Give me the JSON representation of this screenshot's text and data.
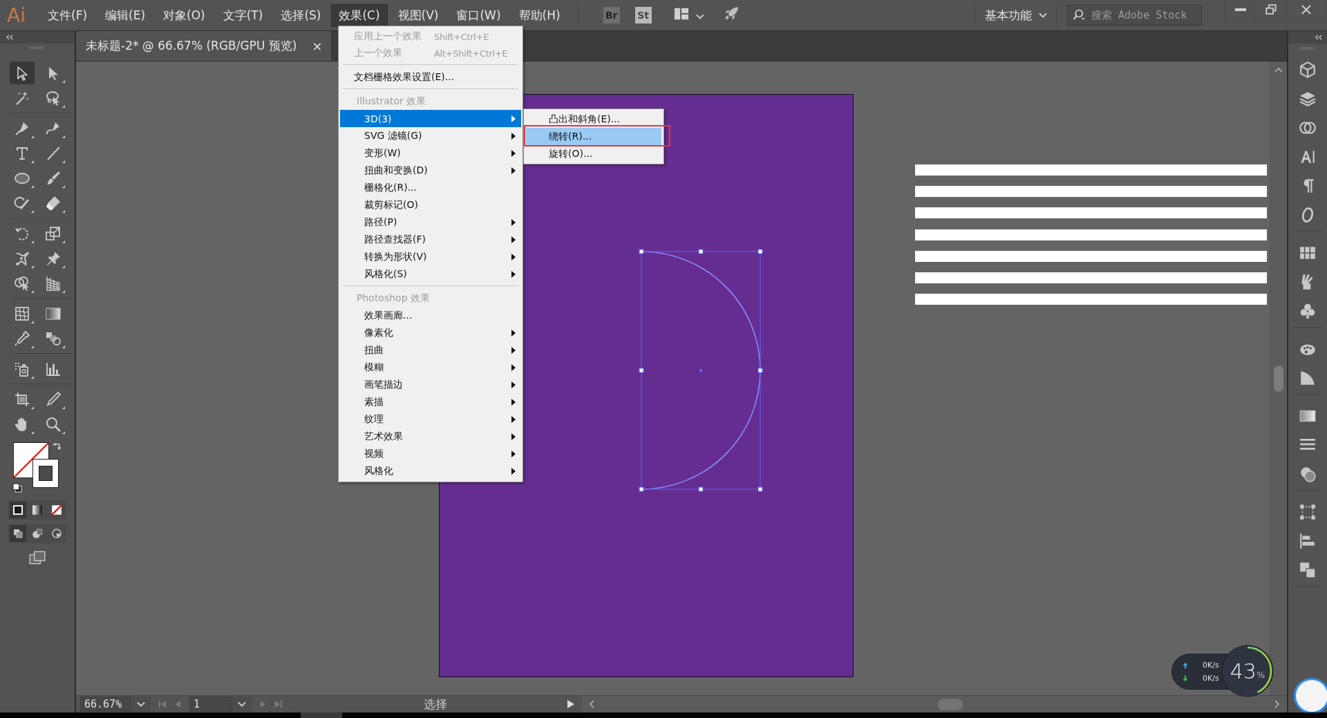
{
  "app_logo": "Ai",
  "menu_bar": [
    {
      "label": "文件(F)",
      "selected": false
    },
    {
      "label": "编辑(E)",
      "selected": false
    },
    {
      "label": "对象(O)",
      "selected": false
    },
    {
      "label": "文字(T)",
      "selected": false
    },
    {
      "label": "选择(S)",
      "selected": false
    },
    {
      "label": "效果(C)",
      "selected": true
    },
    {
      "label": "视图(V)",
      "selected": false
    },
    {
      "label": "窗口(W)",
      "selected": false
    },
    {
      "label": "帮助(H)",
      "selected": false
    }
  ],
  "bridge_buttons": [
    {
      "label": "Br",
      "disabled": true
    },
    {
      "label": "St",
      "disabled": false
    }
  ],
  "workspace": {
    "label": "基本功能"
  },
  "stock_search": {
    "placeholder": "搜索 Adobe Stock"
  },
  "document_tab": {
    "title": "未标题-2* @ 66.67% (RGB/GPU 预览)",
    "close": "×"
  },
  "tools": [
    {
      "kind": "select",
      "selected": true
    },
    {
      "kind": "direct",
      "selected": false
    },
    {
      "kind": "wand",
      "selected": false
    },
    {
      "kind": "lasso",
      "selected": false
    },
    {
      "kind": "pen",
      "selected": false
    },
    {
      "kind": "curvature",
      "selected": false
    },
    {
      "kind": "type",
      "selected": false
    },
    {
      "kind": "line",
      "selected": false
    },
    {
      "kind": "ellipse",
      "selected": false
    },
    {
      "kind": "brush",
      "selected": false
    },
    {
      "kind": "shaper",
      "selected": false
    },
    {
      "kind": "eraser",
      "selected": false
    },
    {
      "kind": "rotate",
      "selected": false
    },
    {
      "kind": "scale",
      "selected": false
    },
    {
      "kind": "puppet",
      "selected": false
    },
    {
      "kind": "pin",
      "selected": false
    },
    {
      "kind": "builder",
      "selected": false
    },
    {
      "kind": "perspective",
      "selected": false
    },
    {
      "kind": "mesh",
      "selected": false
    },
    {
      "kind": "gradient",
      "selected": false
    },
    {
      "kind": "eyedropper",
      "selected": false
    },
    {
      "kind": "blend",
      "selected": false
    },
    {
      "kind": "sprayer",
      "selected": false
    },
    {
      "kind": "graph",
      "selected": false
    },
    {
      "kind": "artboard",
      "selected": false
    },
    {
      "kind": "knife",
      "selected": false
    },
    {
      "kind": "hand",
      "selected": false
    },
    {
      "kind": "zoom",
      "selected": false
    }
  ],
  "color_modes": [
    {
      "kind": "color",
      "selected": true
    },
    {
      "kind": "gradient",
      "selected": false
    },
    {
      "kind": "none",
      "selected": false
    }
  ],
  "draw_modes": [
    {
      "kind": "normal",
      "selected": true
    },
    {
      "kind": "behind",
      "selected": false
    },
    {
      "kind": "inside",
      "selected": false
    }
  ],
  "effect_menu": {
    "items": [
      {
        "kind": "item",
        "label": "应用上一个效果",
        "shortcut": "Shift+Ctrl+E",
        "disabled": true,
        "submenu": false,
        "selected": false
      },
      {
        "kind": "item",
        "label": "上一个效果",
        "shortcut": "Alt+Shift+Ctrl+E",
        "disabled": true,
        "submenu": false,
        "selected": false
      },
      {
        "kind": "separator"
      },
      {
        "kind": "item",
        "label": "文档栅格效果设置(E)...",
        "disabled": false,
        "submenu": false,
        "selected": false
      },
      {
        "kind": "separator"
      },
      {
        "kind": "group",
        "label": "Illustrator 效果",
        "children": [
          {
            "kind": "item",
            "label": "3D(3)",
            "disabled": false,
            "submenu": true,
            "selected": true
          },
          {
            "kind": "item",
            "label": "SVG 滤镜(G)",
            "disabled": false,
            "submenu": true,
            "selected": false
          },
          {
            "kind": "item",
            "label": "变形(W)",
            "disabled": false,
            "submenu": true,
            "selected": false
          },
          {
            "kind": "item",
            "label": "扭曲和变换(D)",
            "disabled": false,
            "submenu": true,
            "selected": false
          },
          {
            "kind": "item",
            "label": "栅格化(R)...",
            "disabled": false,
            "submenu": false,
            "selected": false
          },
          {
            "kind": "item",
            "label": "裁剪标记(O)",
            "disabled": false,
            "submenu": false,
            "selected": false
          },
          {
            "kind": "item",
            "label": "路径(P)",
            "disabled": false,
            "submenu": true,
            "selected": false
          },
          {
            "kind": "item",
            "label": "路径查找器(F)",
            "disabled": false,
            "submenu": true,
            "selected": false
          },
          {
            "kind": "item",
            "label": "转换为形状(V)",
            "disabled": false,
            "submenu": true,
            "selected": false
          },
          {
            "kind": "item",
            "label": "风格化(S)",
            "disabled": false,
            "submenu": true,
            "selected": false
          }
        ]
      },
      {
        "kind": "separator"
      },
      {
        "kind": "group",
        "label": "Photoshop 效果",
        "children": [
          {
            "kind": "item",
            "label": "效果画廊...",
            "disabled": false,
            "submenu": false,
            "selected": false
          },
          {
            "kind": "item",
            "label": "像素化",
            "disabled": false,
            "submenu": true,
            "selected": false
          },
          {
            "kind": "item",
            "label": "扭曲",
            "disabled": false,
            "submenu": true,
            "selected": false
          },
          {
            "kind": "item",
            "label": "模糊",
            "disabled": false,
            "submenu": true,
            "selected": false
          },
          {
            "kind": "item",
            "label": "画笔描边",
            "disabled": false,
            "submenu": true,
            "selected": false
          },
          {
            "kind": "item",
            "label": "素描",
            "disabled": false,
            "submenu": true,
            "selected": false
          },
          {
            "kind": "item",
            "label": "纹理",
            "disabled": false,
            "submenu": true,
            "selected": false
          },
          {
            "kind": "item",
            "label": "艺术效果",
            "disabled": false,
            "submenu": true,
            "selected": false
          },
          {
            "kind": "item",
            "label": "视频",
            "disabled": false,
            "submenu": true,
            "selected": false
          },
          {
            "kind": "item",
            "label": "风格化",
            "disabled": false,
            "submenu": true,
            "selected": false
          }
        ]
      }
    ]
  },
  "submenu_3d": {
    "items": [
      {
        "label": "凸出和斜角(E)...",
        "selected": false,
        "annotated": false
      },
      {
        "label": "绕转(R)...",
        "selected": true,
        "annotated": true
      },
      {
        "label": "旋转(O)...",
        "selected": false,
        "annotated": false
      }
    ]
  },
  "status_bar": {
    "zoom": "66.67%",
    "page": "1",
    "tool": "选择"
  },
  "net_monitor": {
    "upload": "0K/s",
    "download": "0K/s",
    "percent": "43",
    "unit": "%",
    "level": 0.43
  }
}
